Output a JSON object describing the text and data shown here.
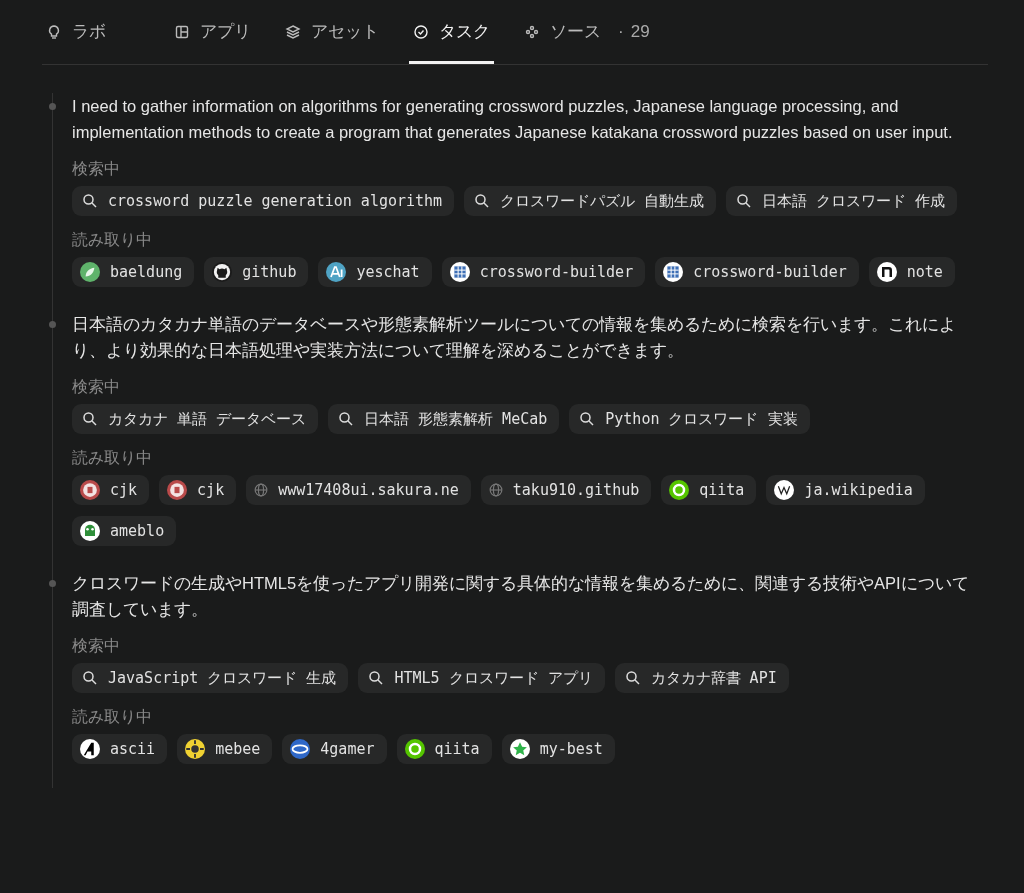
{
  "tabs": [
    {
      "label": "ラボ",
      "kind": "bulb",
      "selected": false
    },
    {
      "label": "アプリ",
      "kind": "app",
      "selected": false
    },
    {
      "label": "アセット",
      "kind": "layers",
      "selected": false
    },
    {
      "label": "タスク",
      "kind": "check",
      "selected": true
    },
    {
      "label": "ソース",
      "kind": "dots",
      "separator": "·",
      "count": "29",
      "selected": false
    }
  ],
  "steps": [
    {
      "text": "I need to gather information on algorithms for generating crossword puzzles, Japanese language processing, and implementation methods to create a program that generates Japanese katakana crossword puzzles based on user input.",
      "search_label": "検索中",
      "searches": [
        "crossword puzzle generation algorithm",
        "クロスワードパズル 自動生成",
        "日本語 クロスワード 作成"
      ],
      "read_label": "読み取り中",
      "sources": [
        {
          "name": "baeldung",
          "kind": "leaf"
        },
        {
          "name": "github",
          "kind": "cat"
        },
        {
          "name": "yeschat",
          "kind": "ai"
        },
        {
          "name": "crossword-builder",
          "kind": "grid"
        },
        {
          "name": "crossword-builder",
          "kind": "grid"
        },
        {
          "name": "note",
          "kind": "arch"
        }
      ]
    },
    {
      "text": "日本語のカタカナ単語のデータベースや形態素解析ツールについての情報を集めるために検索を行います。これにより、より効果的な日本語処理や実装方法について理解を深めることができます。",
      "search_label": "検索中",
      "searches": [
        "カタカナ 単語 データベース",
        "日本語 形態素解析 MeCab",
        "Python クロスワード 実装"
      ],
      "read_label": "読み取り中",
      "sources": [
        {
          "name": "cjk",
          "kind": "seal"
        },
        {
          "name": "cjk",
          "kind": "seal"
        },
        {
          "name": "www17408ui.sakura.ne",
          "kind": "globe"
        },
        {
          "name": "taku910.github",
          "kind": "globe"
        },
        {
          "name": "qiita",
          "kind": "ring"
        },
        {
          "name": "ja.wikipedia",
          "kind": "wiki"
        },
        {
          "name": "ameblo",
          "kind": "frog"
        }
      ]
    },
    {
      "text": "クロスワードの生成やHTML5を使ったアプリ開発に関する具体的な情報を集めるために、関連する技術やAPIについて調査しています。",
      "search_label": "検索中",
      "searches": [
        "JavaScript クロスワード 生成",
        "HTML5 クロスワード アプリ",
        "カタカナ辞書 API"
      ],
      "read_label": "読み取り中",
      "sources": [
        {
          "name": "ascii",
          "kind": "wedge"
        },
        {
          "name": "mebee",
          "kind": "sun"
        },
        {
          "name": "4gamer",
          "kind": "blue"
        },
        {
          "name": "qiita",
          "kind": "ring"
        },
        {
          "name": "my-best",
          "kind": "star"
        }
      ]
    }
  ]
}
